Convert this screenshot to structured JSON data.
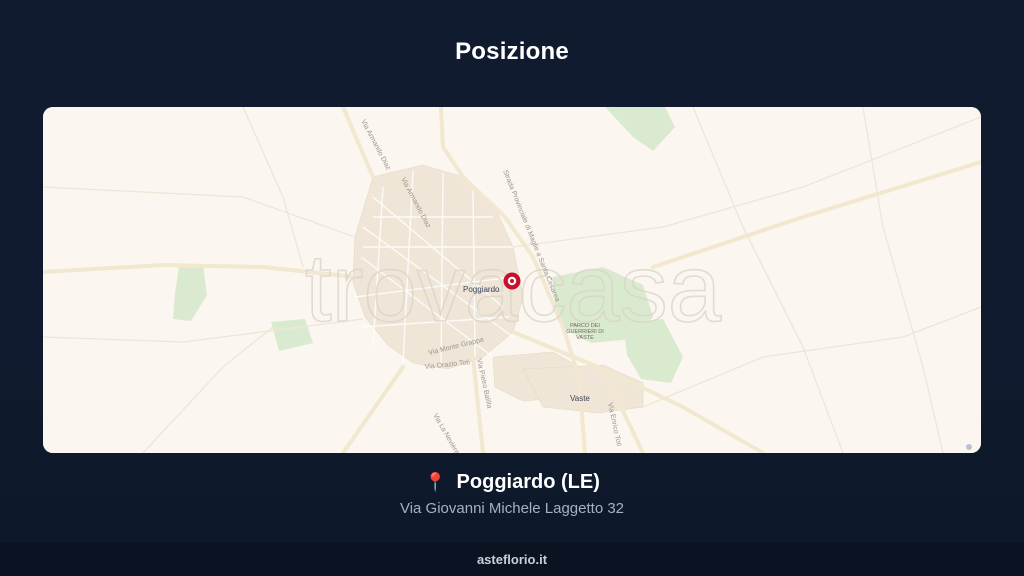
{
  "page": {
    "title": "Posizione"
  },
  "map": {
    "watermark": "trovacasa",
    "labels": {
      "town_main": "Poggiardo",
      "town_secondary": "Vaste",
      "park": [
        "PARCO DEI",
        "GUERRIERI DI",
        "VASTE"
      ],
      "streets": [
        "Via Armando Diaz",
        "Via Armando Diaz",
        "Strada Provinciale di Maglie a Santa Cesarea",
        "Via Monte Grappa",
        "Via Orazio Toti",
        "Via Pietro Balilla",
        "Via Enrico Toti",
        "Via La Neviera"
      ]
    },
    "marker_icon": "location-marker-icon"
  },
  "location": {
    "pin_icon": "📍",
    "city": "Poggiardo (LE)",
    "address": "Via Giovanni Michele Laggetto 32"
  },
  "footer": {
    "text": "asteflorio.it"
  },
  "colors": {
    "background": "#111b30",
    "map_base": "#fbf6ef",
    "green_area": "#cfe6c4",
    "marker": "#c8102e",
    "footer_bg": "#0b1322"
  }
}
